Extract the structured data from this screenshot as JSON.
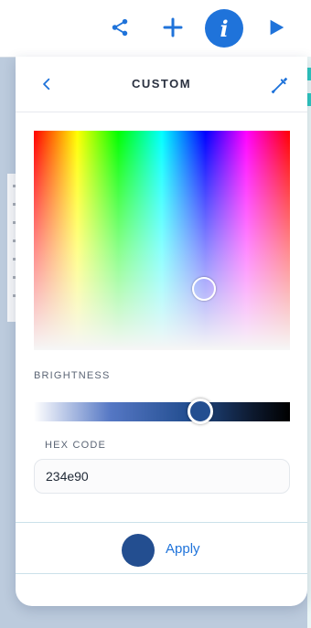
{
  "toolbar": {
    "share_icon": "share-icon",
    "add_icon": "plus-icon",
    "info_glyph": "i",
    "play_icon": "play-icon"
  },
  "panel": {
    "title": "CUSTOM",
    "back_icon": "chevron-left-icon",
    "eyedropper_icon": "eyedropper-icon"
  },
  "brightness": {
    "label": "BRIGHTNESS",
    "value_fraction": 0.65
  },
  "hex": {
    "label": "HEX CODE",
    "value": "234e90"
  },
  "footer": {
    "apply_label": "Apply",
    "swatch_color": "#234e90"
  },
  "colors": {
    "accent": "#1f73da",
    "selected": "#234e90"
  }
}
